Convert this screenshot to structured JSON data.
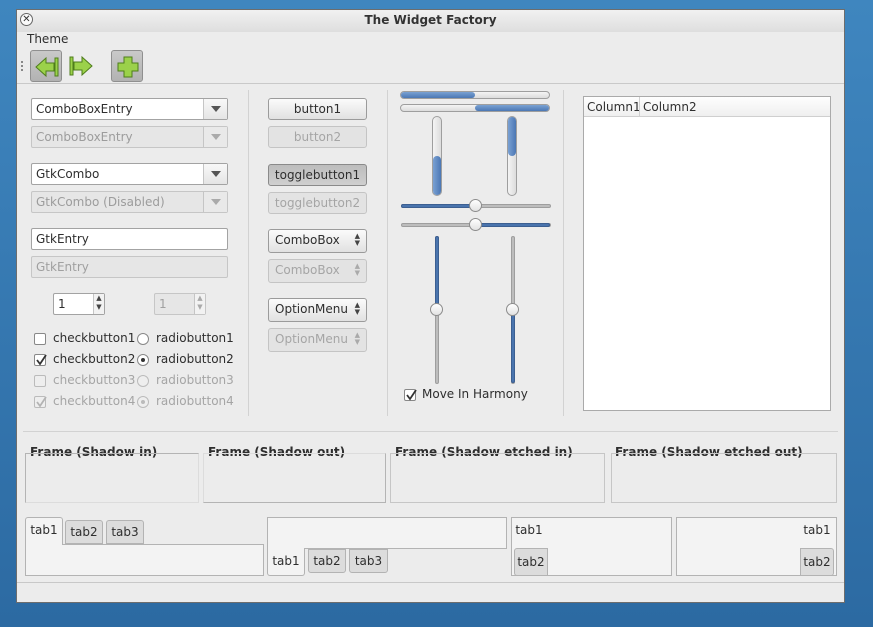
{
  "window": {
    "title": "The Widget Factory"
  },
  "menubar": {
    "items": [
      "Theme"
    ]
  },
  "toolbar": {
    "buttons": [
      "back-icon",
      "forward-icon",
      "add-icon"
    ]
  },
  "left": {
    "combo_entry": "ComboBoxEntry",
    "combo_entry_disabled": "ComboBoxEntry",
    "gtk_combo": "GtkCombo",
    "gtk_combo_disabled": "GtkCombo (Disabled)",
    "entry": "GtkEntry",
    "entry_disabled": "GtkEntry",
    "spin": "1",
    "spin_disabled": "1",
    "checks": [
      {
        "label": "checkbutton1",
        "checked": false,
        "disabled": false
      },
      {
        "label": "checkbutton2",
        "checked": true,
        "disabled": false
      },
      {
        "label": "checkbutton3",
        "checked": false,
        "disabled": true
      },
      {
        "label": "checkbutton4",
        "checked": true,
        "disabled": true
      }
    ],
    "radios": [
      {
        "label": "radiobutton1",
        "selected": false,
        "disabled": false
      },
      {
        "label": "radiobutton2",
        "selected": true,
        "disabled": false
      },
      {
        "label": "radiobutton3",
        "selected": false,
        "disabled": true
      },
      {
        "label": "radiobutton4",
        "selected": true,
        "disabled": true
      }
    ]
  },
  "middle": {
    "button1": "button1",
    "button2": "button2",
    "toggle1": "togglebutton1",
    "toggle2": "togglebutton2",
    "combobox": "ComboBox",
    "combobox_disabled": "ComboBox",
    "optionmenu": "OptionMenu",
    "optionmenu_disabled": "OptionMenu"
  },
  "ranges": {
    "progress_h1": 0.5,
    "progress_h2": 0.5,
    "progress_v1": 0.5,
    "progress_v2": 0.5,
    "scale_h1": 0.5,
    "scale_h2": 0.5,
    "scale_v1": 0.5,
    "scale_v2": 0.5,
    "move_in_harmony": "Move In Harmony"
  },
  "tree": {
    "columns": [
      "Column1",
      "Column2"
    ]
  },
  "frames": [
    "Frame (Shadow in)",
    "Frame (Shadow out)",
    "Frame (Shadow etched in)",
    "Frame (Shadow etched out)"
  ],
  "notebooks": {
    "top_tabs": [
      "tab1",
      "tab2",
      "tab3"
    ],
    "bottom_tabs": [
      "tab1",
      "tab2",
      "tab3"
    ],
    "left_tabs": [
      "tab1",
      "tab2"
    ],
    "right_tabs": [
      "tab1",
      "tab2"
    ]
  }
}
